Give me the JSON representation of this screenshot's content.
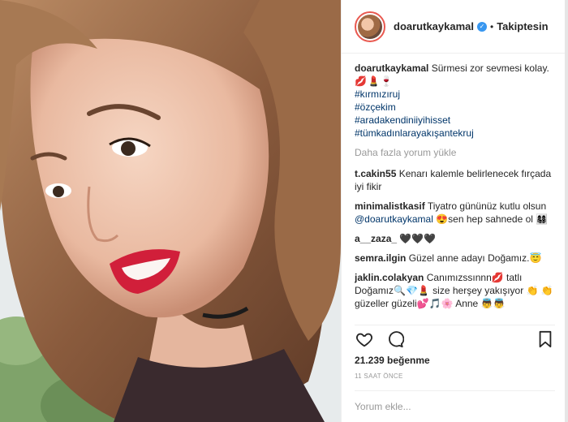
{
  "header": {
    "username": "doarutkaykamal",
    "verified_icon": "verified-badge-icon",
    "separator": "•",
    "follow_status": "Takiptesin"
  },
  "caption": {
    "username": "doarutkaykamal",
    "text": "Sürmesi zor sevmesi kolay.",
    "emojis": "💋💄🍷",
    "hashtags": [
      "#kırmızıruj",
      "#özçekim",
      "#aradakendiniiyihisset",
      "#tümkadınlarayakışantekruj"
    ]
  },
  "load_more": "Daha fazla yorum yükle",
  "comments": [
    {
      "username": "t.cakin55",
      "text": "Kenarı kalemle belirlenecek fırçada iyi fikir"
    },
    {
      "username": "minimalistkasif",
      "text_before": "Tiyatro gününüz kutlu olsun",
      "mention": "@doarutkaykamal",
      "text_after": "😍sen hep sahnede ol 👩‍👩‍👧‍👦"
    },
    {
      "username": "a__zaza_",
      "text": "🖤🖤🖤"
    },
    {
      "username": "semra.ilgin",
      "text": "Güzel anne adayı Doğamız.😇"
    },
    {
      "username": "jaklin.colakyan",
      "text": "Canımızssınnn💋 tatlı Doğamız🔍💎💄 size herşey yakışıyor 👏 👏güzeller güzeli💕🎵🌸 Anne 👼👼"
    }
  ],
  "actions": {
    "like_icon": "heart-icon",
    "comment_icon": "comment-icon",
    "save_icon": "bookmark-icon"
  },
  "likes": "21.239 beğenme",
  "timestamp": "11 SAAT ÖNCE",
  "add_comment": {
    "placeholder": "Yorum ekle..."
  },
  "colors": {
    "link": "#003569",
    "muted": "#999999",
    "text": "#262626",
    "lips": "#d11f3a"
  }
}
